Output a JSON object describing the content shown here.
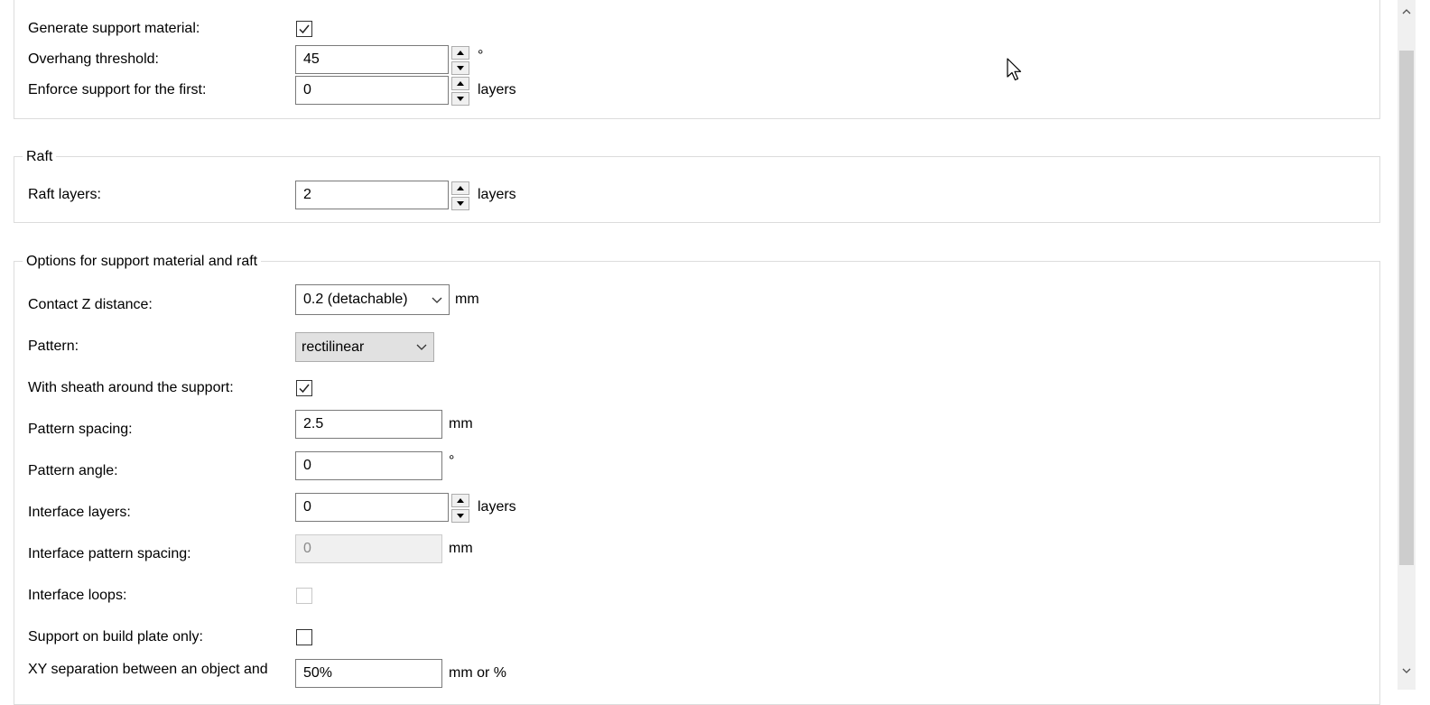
{
  "support": {
    "generate_support": {
      "label": "Generate support material:",
      "checked": true
    },
    "overhang_threshold": {
      "label": "Overhang threshold:",
      "value": "45",
      "unit": "°"
    },
    "enforce_support": {
      "label": "Enforce support for the first:",
      "value": "0",
      "unit": "layers"
    }
  },
  "raft": {
    "title": "Raft",
    "raft_layers": {
      "label": "Raft layers:",
      "value": "2",
      "unit": "layers"
    }
  },
  "options": {
    "title": "Options for support material and raft",
    "contact_z": {
      "label": "Contact Z distance:",
      "value": "0.2 (detachable)",
      "unit": "mm"
    },
    "pattern": {
      "label": "Pattern:",
      "value": "rectilinear"
    },
    "sheath": {
      "label": "With sheath around the support:",
      "checked": true
    },
    "pattern_spacing": {
      "label": "Pattern spacing:",
      "value": "2.5",
      "unit": "mm"
    },
    "pattern_angle": {
      "label": "Pattern angle:",
      "value": "0",
      "unit": "°"
    },
    "interface_layers": {
      "label": "Interface layers:",
      "value": "0",
      "unit": "layers"
    },
    "interface_spacing": {
      "label": "Interface pattern spacing:",
      "value": "0",
      "unit": "mm",
      "disabled": true
    },
    "interface_loops": {
      "label": "Interface loops:",
      "checked": false,
      "disabled": true
    },
    "build_plate_only": {
      "label": "Support on build plate only:",
      "checked": false
    },
    "xy_separation": {
      "label": "XY separation between an object and",
      "value": "50%",
      "unit": "mm or %"
    }
  },
  "icons": {
    "checkmark": "check-icon",
    "spin_up": "triangle-up-icon",
    "spin_down": "triangle-down-icon",
    "dropdown": "chevron-down-icon",
    "scroll_up": "chevron-up-icon",
    "scroll_down": "chevron-down-icon",
    "cursor": "mouse-pointer-icon"
  },
  "colors": {
    "group_border": "#dcdcdc",
    "field_border": "#7a7a7a",
    "disabled_bg": "#f0f0f0",
    "scrollbar_bg": "#f0f0f0",
    "scroll_thumb": "#cdcdcd"
  }
}
